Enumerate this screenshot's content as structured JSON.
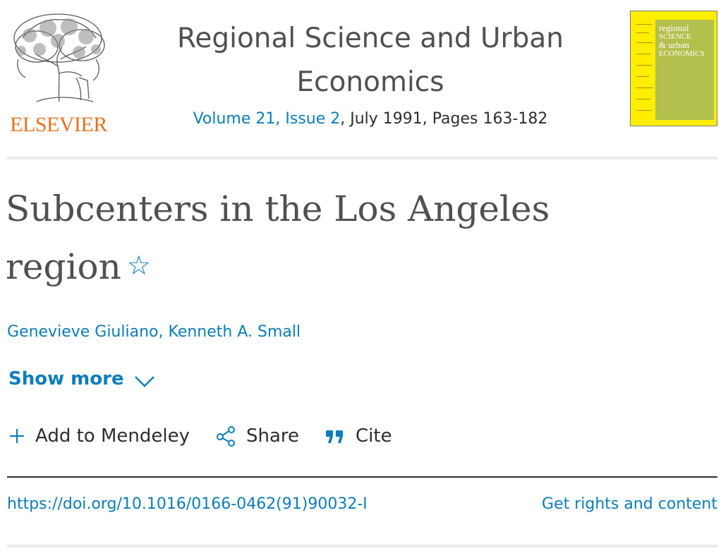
{
  "publisher": {
    "logo_text": "ELSEVIER"
  },
  "journal": {
    "title_line1": "Regional Science and Urban",
    "title_line2": "Economics",
    "issue_link": "Volume 21, Issue 2",
    "issue_rest": ", July 1991, Pages 163-182",
    "cover_text_1": "regional",
    "cover_text_2": "SCIENCE",
    "cover_text_3": "& urban",
    "cover_text_4": "ECONOMICS"
  },
  "article": {
    "title_line1": "Subcenters in the Los Angeles",
    "title_line2": "region",
    "star_glyph": "☆",
    "authors": [
      "Genevieve Giuliano",
      "Kenneth A. Small"
    ],
    "author_separator": ", "
  },
  "show_more": {
    "label": "Show more"
  },
  "actions": {
    "mendeley": "Add to Mendeley",
    "share": "Share",
    "cite": "Cite"
  },
  "doi": {
    "url": "https://doi.org/10.1016/0166-0462(91)90032-I"
  },
  "rights": {
    "label": "Get rights and content"
  },
  "colors": {
    "link": "#0c7dbb",
    "brand_orange": "#e9711c",
    "cover_yellow": "#ffee00",
    "cover_green": "#b2c04d"
  },
  "icons": [
    "elsevier-tree-logo",
    "star-icon",
    "chevron-down-icon",
    "plus-icon",
    "share-icon",
    "quote-icon"
  ]
}
